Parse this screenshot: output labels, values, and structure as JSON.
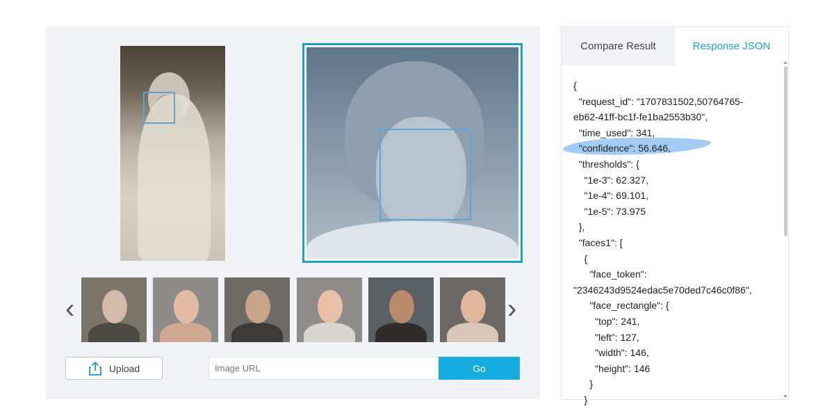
{
  "viewer": {
    "prev_arrow": "‹",
    "next_arrow": "›",
    "thumbnails": [
      {
        "name": "elderly-man-with-glasses",
        "bg": "#7a7466",
        "skin": "#d2b9a8",
        "cloth": "#4c4a44"
      },
      {
        "name": "woman-short-hair",
        "bg": "#8d8c8a",
        "skin": "#e3bca6",
        "cloth": "#cfa795"
      },
      {
        "name": "man-with-glasses-beard",
        "bg": "#6f6b66",
        "skin": "#c8a48a",
        "cloth": "#3b3a38"
      },
      {
        "name": "girl-brown-hair",
        "bg": "#8f8d8b",
        "skin": "#e8c2a6",
        "cloth": "#d8d4d0"
      },
      {
        "name": "smiling-woman-dark-hair",
        "bg": "#5a5f63",
        "skin": "#b98a6b",
        "cloth": "#2e2b2a"
      },
      {
        "name": "woman-hand-on-face",
        "bg": "#6b6865",
        "skin": "#e0b69c",
        "cloth": "#d9c6b9"
      }
    ]
  },
  "controls": {
    "upload_label": "Upload",
    "url_placeholder": "Image URL",
    "go_label": "Go"
  },
  "tabs": {
    "compare_result": "Compare Result",
    "response_json": "Response JSON"
  },
  "json_lines": [
    "{",
    "  \"request_id\": \"1707831502,50764765-",
    "eb62-41ff-bc1f-fe1ba2553b30\",",
    "  \"time_used\": 341,",
    "  \"confidence\": 56.646,",
    "  \"thresholds\": {",
    "    \"1e-3\": 62.327,",
    "    \"1e-4\": 69.101,",
    "    \"1e-5\": 73.975",
    "  },",
    "  \"faces1\": [",
    "    {",
    "      \"face_token\":",
    "\"2346243d9524edac5e70ded7c46c0f86\",",
    "      \"face_rectangle\": {",
    "        \"top\": 241,",
    "        \"left\": 127,",
    "        \"width\": 146,",
    "        \"height\": 146",
    "      }",
    "    }"
  ],
  "colors": {
    "accent": "#17acdf",
    "active_tab_text": "#19a7c9",
    "face_box": "#5ea5d4",
    "highlight": "#92c3f1"
  }
}
